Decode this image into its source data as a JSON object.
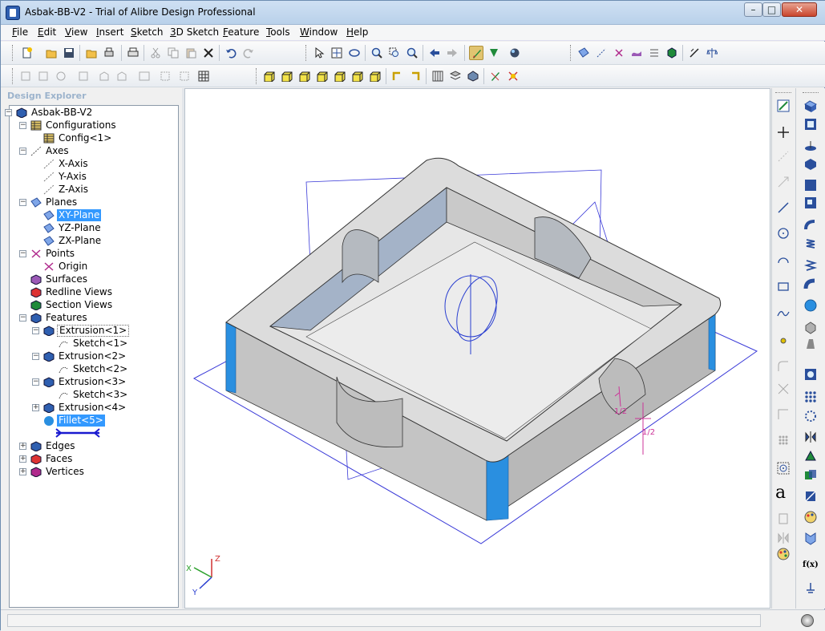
{
  "window": {
    "title": "Asbak-BB-V2 - Trial of Alibre Design Professional",
    "minimize": "–",
    "maximize": "□",
    "close": "✕"
  },
  "menu": [
    {
      "label": "File",
      "key": "F"
    },
    {
      "label": "Edit",
      "key": "E"
    },
    {
      "label": "View",
      "key": "V"
    },
    {
      "label": "Insert",
      "key": "I"
    },
    {
      "label": "Sketch",
      "key": "S"
    },
    {
      "label": "3D Sketch",
      "key": "3"
    },
    {
      "label": "Feature",
      "key": "F"
    },
    {
      "label": "Tools",
      "key": "T"
    },
    {
      "label": "Window",
      "key": "W"
    },
    {
      "label": "Help",
      "key": "H"
    }
  ],
  "explorer": {
    "title": "Design Explorer",
    "nodes": [
      {
        "label": "Asbak-BB-V2",
        "icon": "part-icon"
      },
      {
        "label": "Configurations",
        "icon": "configurations-icon"
      },
      {
        "label": "Config<1>",
        "icon": "config-icon"
      },
      {
        "label": "Axes",
        "icon": "axes-icon"
      },
      {
        "label": "X-Axis",
        "icon": "axis-icon"
      },
      {
        "label": "Y-Axis",
        "icon": "axis-icon"
      },
      {
        "label": "Z-Axis",
        "icon": "axis-icon"
      },
      {
        "label": "Planes",
        "icon": "planes-icon"
      },
      {
        "label": "XY-Plane",
        "icon": "plane-icon"
      },
      {
        "label": "YZ-Plane",
        "icon": "plane-icon"
      },
      {
        "label": "ZX-Plane",
        "icon": "plane-icon"
      },
      {
        "label": "Points",
        "icon": "points-icon"
      },
      {
        "label": "Origin",
        "icon": "origin-icon"
      },
      {
        "label": "Surfaces",
        "icon": "surfaces-icon"
      },
      {
        "label": "Redline Views",
        "icon": "redline-views-icon"
      },
      {
        "label": "Section Views",
        "icon": "section-views-icon"
      },
      {
        "label": "Features",
        "icon": "features-icon"
      },
      {
        "label": "Extrusion<1>",
        "icon": "extrusion-icon"
      },
      {
        "label": "Sketch<1>",
        "icon": "sketch-icon"
      },
      {
        "label": "Extrusion<2>",
        "icon": "extrusion-icon"
      },
      {
        "label": "Sketch<2>",
        "icon": "sketch-icon"
      },
      {
        "label": "Extrusion<3>",
        "icon": "extrusion-icon"
      },
      {
        "label": "Sketch<3>",
        "icon": "sketch-icon"
      },
      {
        "label": "Extrusion<4>",
        "icon": "extrusion-icon"
      },
      {
        "label": "Fillet<5>",
        "icon": "fillet-icon"
      },
      {
        "label": "Edges",
        "icon": "edges-icon"
      },
      {
        "label": "Faces",
        "icon": "faces-icon"
      },
      {
        "label": "Vertices",
        "icon": "vertices-icon"
      }
    ]
  },
  "viewport": {
    "dim1": "1/2",
    "dim2": "1/2",
    "triad": {
      "x": "X",
      "y": "Y",
      "z": "Z"
    }
  },
  "rightbar": {
    "text_tool": "a",
    "function_tool": "f(x)"
  },
  "colors": {
    "selection": "#3399ff",
    "plane": "#3a3ad8",
    "part_top": "#d9d9d9",
    "part_side": "#c6c6c6",
    "fillet": "#2a8fe0",
    "dimension": "#cc3399"
  }
}
